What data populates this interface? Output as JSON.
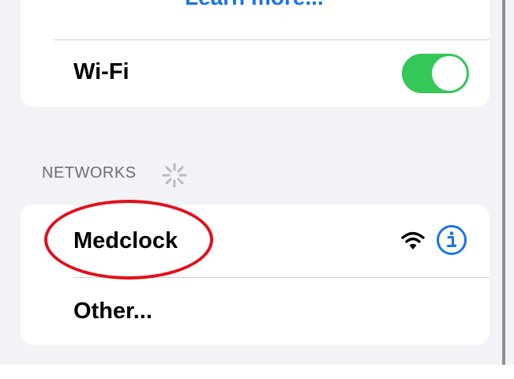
{
  "top_card": {
    "learn_more_label": "Learn more..."
  },
  "wifi_row": {
    "label": "Wi-Fi",
    "toggle_on": true,
    "toggle_color": "#34c759"
  },
  "networks_section": {
    "header": "NETWORKS",
    "loading_icon": "spinner-icon",
    "networks": [
      {
        "name": "Medclock",
        "signal_icon": "wifi-icon",
        "info_icon": "info-icon"
      }
    ],
    "other_label": "Other..."
  },
  "annotation": {
    "color": "#e0101b"
  },
  "colors": {
    "accent": "#1a73e8",
    "background": "#f2f2f7"
  }
}
